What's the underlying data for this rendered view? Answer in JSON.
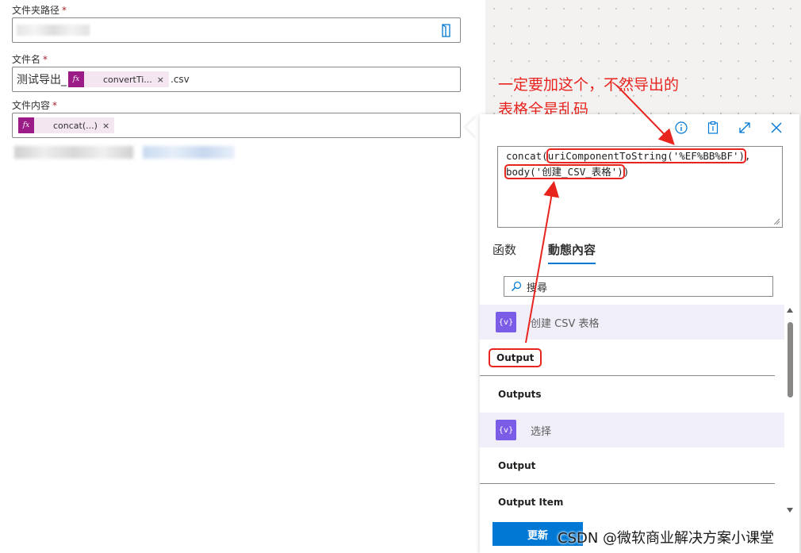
{
  "form": {
    "folder_label": "文件夹路径",
    "file_name_label": "文件名",
    "file_name_prefix": "测试导出_",
    "file_name_token": "convertTi...",
    "file_name_suffix": ".csv",
    "content_label": "文件内容",
    "content_token": "concat(...)",
    "required_mark": "*",
    "token_close": "×",
    "fx_glyph": "fx"
  },
  "annotation": {
    "line1": "一定要加这个，不然导出的",
    "line2": "表格全是乱码",
    "color": "#e8241f"
  },
  "panel": {
    "expr_start": "concat(",
    "expr_hl1": "uriComponentToString('%EF%BB%BF')",
    "expr_mid": ",",
    "expr_hl2": "body('创建_CSV_表格')",
    "expr_end": ")",
    "tabs": [
      "函数",
      "動態內容"
    ],
    "search_placeholder": "搜尋",
    "groups": [
      {
        "label": "创建 CSV 表格",
        "icon": "{v}",
        "items": [
          "Output",
          "Outputs"
        ]
      },
      {
        "label": "选择",
        "icon": "{v}",
        "items": [
          "Output",
          "Output Item"
        ]
      }
    ],
    "update_button": "更新"
  },
  "watermark": "CSDN @微软商业解决方案小课堂",
  "colors": {
    "accent": "#0078d4",
    "token": "#9b1b87",
    "group_icon": "#7a5ce6"
  }
}
